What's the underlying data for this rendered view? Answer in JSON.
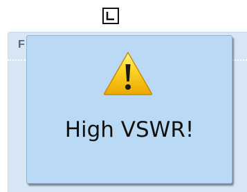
{
  "background": {
    "label": "F"
  },
  "dialog": {
    "icon": "warning-triangle-icon",
    "message": "High VSWR!"
  },
  "top_icon": "window-square-icon",
  "colors": {
    "dialog_bg": "#bad9f4",
    "panel_bg": "#d6e6f4",
    "warning_yellow": "#f2c200"
  }
}
